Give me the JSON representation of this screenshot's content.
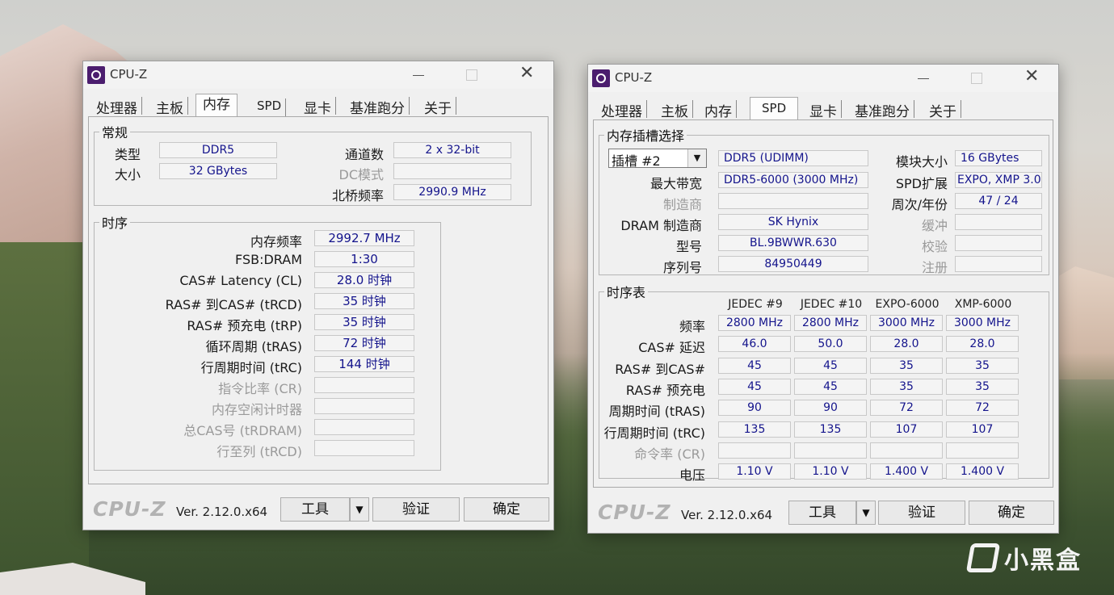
{
  "left": {
    "title": "CPU-Z",
    "tabs": [
      "处理器",
      "主板",
      "内存",
      "SPD",
      "显卡",
      "基准跑分",
      "关于"
    ],
    "general": {
      "legend": "常规",
      "type_label": "类型",
      "type_value": "DDR5",
      "size_label": "大小",
      "size_value": "32 GBytes",
      "channels_label": "通道数",
      "channels_value": "2 x 32-bit",
      "dc_label": "DC模式",
      "dc_value": "",
      "nb_label": "北桥频率",
      "nb_value": "2990.9 MHz"
    },
    "timings": {
      "legend": "时序",
      "rows": [
        {
          "label": "内存频率",
          "value": "2992.7 MHz"
        },
        {
          "label": "FSB:DRAM",
          "value": "1:30"
        },
        {
          "label": "CAS# Latency (CL)",
          "value": "28.0 时钟"
        },
        {
          "label": "RAS# 到CAS# (tRCD)",
          "value": "35 时钟"
        },
        {
          "label": "RAS# 预充电 (tRP)",
          "value": "35 时钟"
        },
        {
          "label": "循环周期 (tRAS)",
          "value": "72 时钟"
        },
        {
          "label": "行周期时间 (tRC)",
          "value": "144 时钟"
        },
        {
          "label": "指令比率 (CR)",
          "value": ""
        },
        {
          "label": "内存空闲计时器",
          "value": ""
        },
        {
          "label": "总CAS号 (tRDRAM)",
          "value": ""
        },
        {
          "label": "行至列 (tRCD)",
          "value": ""
        }
      ]
    },
    "footer": {
      "brand": "CPU-Z",
      "version": "Ver. 2.12.0.x64",
      "tools": "工具",
      "validate": "验证",
      "ok": "确定"
    }
  },
  "right": {
    "title": "CPU-Z",
    "tabs": [
      "处理器",
      "主板",
      "内存",
      "SPD",
      "显卡",
      "基准跑分",
      "关于"
    ],
    "slot": {
      "legend": "内存插槽选择",
      "slot_select": "插槽 #2",
      "type_value": "DDR5 (UDIMM)",
      "module_size_label": "模块大小",
      "module_size_value": "16 GBytes",
      "max_bw_label": "最大带宽",
      "max_bw_value": "DDR5-6000 (3000 MHz)",
      "spd_ext_label": "SPD扩展",
      "spd_ext_value": "EXPO, XMP 3.0",
      "mfr_label": "制造商",
      "mfr_value": "",
      "week_year_label": "周次/年份",
      "week_year_value": "47 / 24",
      "dram_mfr_label": "DRAM 制造商",
      "dram_mfr_value": "SK Hynix",
      "buffer_label": "缓冲",
      "buffer_value": "",
      "part_label": "型号",
      "part_value": "BL.9BWWR.630",
      "check_label": "校验",
      "check_value": "",
      "serial_label": "序列号",
      "serial_value": "84950449",
      "reg_label": "注册",
      "reg_value": ""
    },
    "timing_table": {
      "legend": "时序表",
      "columns": [
        "JEDEC #9",
        "JEDEC #10",
        "EXPO-6000",
        "XMP-6000"
      ],
      "rows": [
        {
          "label": "频率",
          "values": [
            "2800 MHz",
            "2800 MHz",
            "3000 MHz",
            "3000 MHz"
          ]
        },
        {
          "label": "CAS# 延迟",
          "values": [
            "46.0",
            "50.0",
            "28.0",
            "28.0"
          ]
        },
        {
          "label": "RAS# 到CAS#",
          "values": [
            "45",
            "45",
            "35",
            "35"
          ]
        },
        {
          "label": "RAS# 预充电",
          "values": [
            "45",
            "45",
            "35",
            "35"
          ]
        },
        {
          "label": "周期时间 (tRAS)",
          "values": [
            "90",
            "90",
            "72",
            "72"
          ]
        },
        {
          "label": "行周期时间 (tRC)",
          "values": [
            "135",
            "135",
            "107",
            "107"
          ]
        },
        {
          "label": "命令率 (CR)",
          "values": [
            "",
            "",
            "",
            ""
          ]
        },
        {
          "label": "电压",
          "values": [
            "1.10 V",
            "1.10 V",
            "1.400 V",
            "1.400 V"
          ]
        }
      ]
    },
    "footer": {
      "brand": "CPU-Z",
      "version": "Ver. 2.12.0.x64",
      "tools": "工具",
      "validate": "验证",
      "ok": "确定"
    }
  },
  "watermark": "小黑盒"
}
